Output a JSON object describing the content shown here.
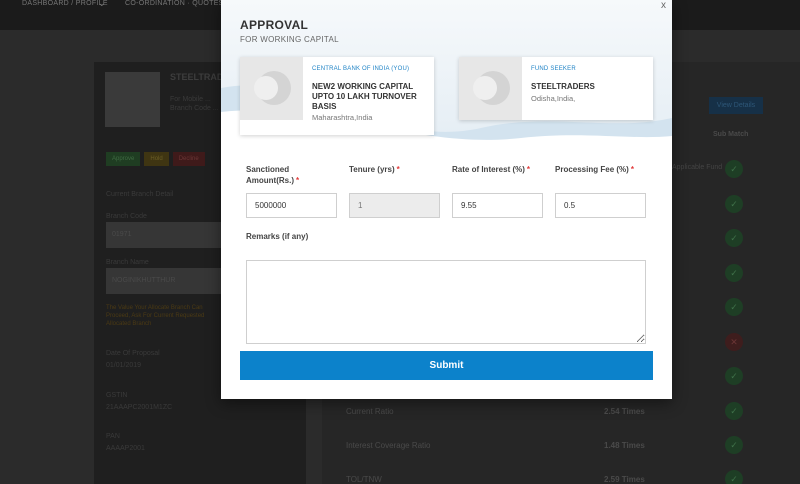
{
  "background": {
    "topbar": {
      "left_text": "DASHBOARD / PROFILE",
      "chevron": "chevron-down-icon",
      "right_text": "CO-ORDINATION · QUOTES"
    },
    "profile": {
      "title": "STEELTRAD",
      "sub1": "For Mobile ...",
      "sub2": "Branch Code ..."
    },
    "tags": [
      "Approve",
      "Hold",
      "Decline"
    ],
    "labels": {
      "current_branch": "Current Branch Detail",
      "branch_code": "Branch Code",
      "branch_code_value": "01971",
      "branch_name": "Branch Name",
      "branch_name_value": "NOGINIKHUTTHUR",
      "warning": "The Value Your Allocate Branch Can Proceed, Ask For Current Requested Allocated Branch",
      "date_of_proposal": "Date Of Proposal",
      "date_value": "01/01/2019",
      "gstin": "GSTIN",
      "gstin_value": "21AAAPC2001M1ZC",
      "pan": "PAN",
      "pan_value": "AAAAP2001"
    },
    "view_details": "View Details",
    "status_header": "Sub Match",
    "side_value": "Applicable Fund",
    "rows": [
      {
        "label": "Current Ratio",
        "value": "2.54 Times"
      },
      {
        "label": "Interest Coverage Ratio",
        "value": "1.48 Times"
      },
      {
        "label": "TOL/TNW",
        "value": "2.59 Times"
      }
    ]
  },
  "modal": {
    "close": "x",
    "title": "APPROVAL",
    "subtitle": "FOR WORKING CAPITAL",
    "lender": {
      "role": "CENTRAL BANK OF INDIA (YOU)",
      "name": "NEW2 WORKING CAPITAL UPTO 10 LAKH TURNOVER BASIS",
      "location": "Maharashtra,India"
    },
    "seeker": {
      "role": "FUND SEEKER",
      "name": "STEELTRADERS",
      "location": "Odisha,India,"
    },
    "fields": {
      "sanctioned": {
        "label": "Sanctioned Amount(Rs.)",
        "value": "5000000"
      },
      "tenure": {
        "label": "Tenure (yrs)",
        "value": "1"
      },
      "roi": {
        "label": "Rate of Interest (%)",
        "value": "9.55"
      },
      "fee": {
        "label": "Processing Fee (%)",
        "value": "0.5"
      },
      "remarks": {
        "label": "Remarks (if any)",
        "value": ""
      }
    },
    "required_mark": "*",
    "submit_label": "Submit"
  }
}
